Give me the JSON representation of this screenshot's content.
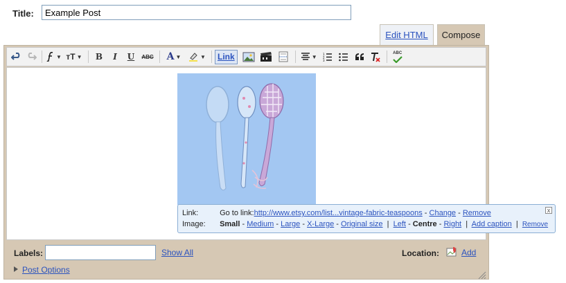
{
  "title": {
    "label": "Title:",
    "value": "Example Post"
  },
  "tabs": [
    {
      "label": "Edit HTML",
      "active": false
    },
    {
      "label": "Compose",
      "active": true
    }
  ],
  "toolbar": {
    "link_label": "Link",
    "bold": "B",
    "italic": "I",
    "underline": "U",
    "strikethrough": "ABC",
    "font_color": "A",
    "font_size": "тT",
    "spell": "ABC"
  },
  "bubble": {
    "link_label": "Link:",
    "goto_text": "Go to link:",
    "url": "http://www.etsy.com/list...vintage-fabric-teaspoons",
    "change": "Change",
    "remove": "Remove",
    "image_label": "Image:",
    "size_current": "Small",
    "sizes": [
      "Medium",
      "Large",
      "X-Large",
      "Original size"
    ],
    "align_left": "Left",
    "align_current": "Centre",
    "align_right": "Right",
    "add_caption": "Add caption",
    "image_remove": "Remove",
    "close": "x"
  },
  "bottom": {
    "labels_label": "Labels:",
    "show_all": "Show All",
    "location_label": "Location:",
    "add": "Add",
    "post_options": "Post Options"
  },
  "colors": {
    "frame": "#d6c8b4",
    "link": "#2a52be",
    "image_bg": "#9ec4f2",
    "bubble_bg": "#e8f1fb"
  }
}
